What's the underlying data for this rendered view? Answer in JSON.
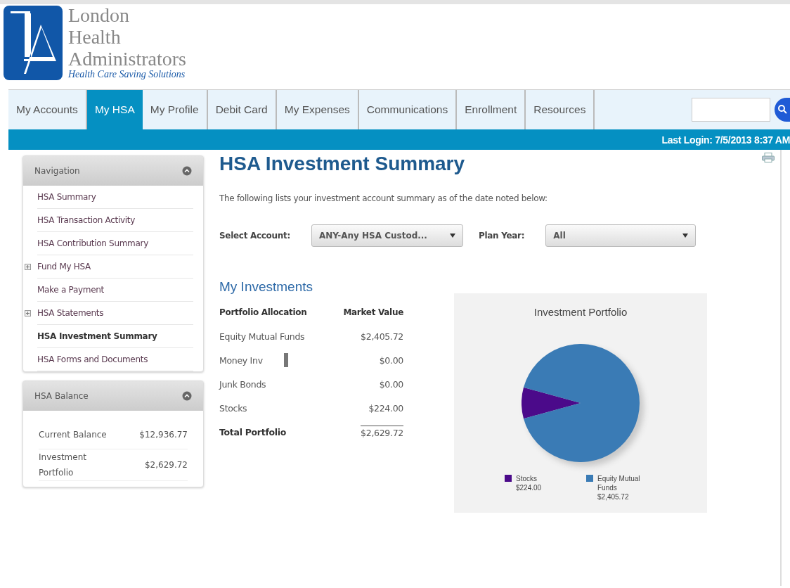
{
  "logo": {
    "lines": [
      "London",
      "Health",
      "Administrators"
    ],
    "tagline": "Health Care Saving Solutions"
  },
  "tabs": [
    {
      "label": "My Accounts",
      "selected": false
    },
    {
      "label": "My HSA",
      "selected": true
    },
    {
      "label": "My Profile",
      "selected": false
    },
    {
      "label": "Debit Card",
      "selected": false
    },
    {
      "label": "My Expenses",
      "selected": false
    },
    {
      "label": "Communications",
      "selected": false
    },
    {
      "label": "Enrollment",
      "selected": false
    },
    {
      "label": "Resources",
      "selected": false
    }
  ],
  "last_login": "Last Login: 7/5/2013 8:37 AM",
  "sidebar": {
    "navigation": {
      "title": "Navigation",
      "expanded": true,
      "items": [
        {
          "label": "HSA Summary",
          "selected": false,
          "expandable": false
        },
        {
          "label": "HSA Transaction Activity",
          "selected": false,
          "expandable": false
        },
        {
          "label": "HSA Contribution Summary",
          "selected": false,
          "expandable": false
        },
        {
          "label": "Fund My HSA",
          "selected": false,
          "expandable": true
        },
        {
          "label": "Make a Payment",
          "selected": false,
          "expandable": false
        },
        {
          "label": "HSA Statements",
          "selected": false,
          "expandable": true
        },
        {
          "label": "HSA Investment Summary",
          "selected": true,
          "expandable": false
        },
        {
          "label": "HSA Forms and Documents",
          "selected": false,
          "expandable": false
        }
      ]
    },
    "balance": {
      "title": "HSA Balance",
      "expanded": true,
      "rows": [
        {
          "label": "Current Balance",
          "value": "$12,936.77"
        },
        {
          "label": "Investment Portfolio",
          "value": "$2,629.72"
        }
      ]
    }
  },
  "main": {
    "title": "HSA Investment Summary",
    "intro": "The following lists your investment account summary as of the date noted below:",
    "filters": [
      {
        "label": "Select Account:",
        "value": "ANY-Any HSA Custod..."
      },
      {
        "label": "Plan Year:",
        "value": "All"
      }
    ],
    "section_title": "My Investments",
    "table": {
      "columns": [
        "Portfolio Allocation",
        "Market Value"
      ],
      "rows": [
        {
          "kind": "item",
          "label": "Equity Mutual Funds",
          "value": "$2,405.72",
          "marker": false
        },
        {
          "kind": "item",
          "label": "Money Inv",
          "value": "$0.00",
          "marker": true
        },
        {
          "kind": "item",
          "label": "Junk Bonds",
          "value": "$0.00",
          "marker": false
        },
        {
          "kind": "item",
          "label": "Stocks",
          "value": "$224.00",
          "marker": false
        },
        {
          "kind": "total",
          "label": "Total Portfolio",
          "value": "$2,629.72",
          "marker": false
        }
      ]
    },
    "chart": {
      "chart_data": {
        "type": "pie",
        "title": "Investment Portfolio",
        "categories": [
          "Stocks",
          "Equity Mutual Funds"
        ],
        "values": [
          224.0,
          2405.72
        ],
        "colors": [
          "#4b0a8a",
          "#3a7bb5"
        ],
        "value_labels": [
          "$224.00",
          "$2,405.72"
        ],
        "legend": true
      }
    }
  }
}
